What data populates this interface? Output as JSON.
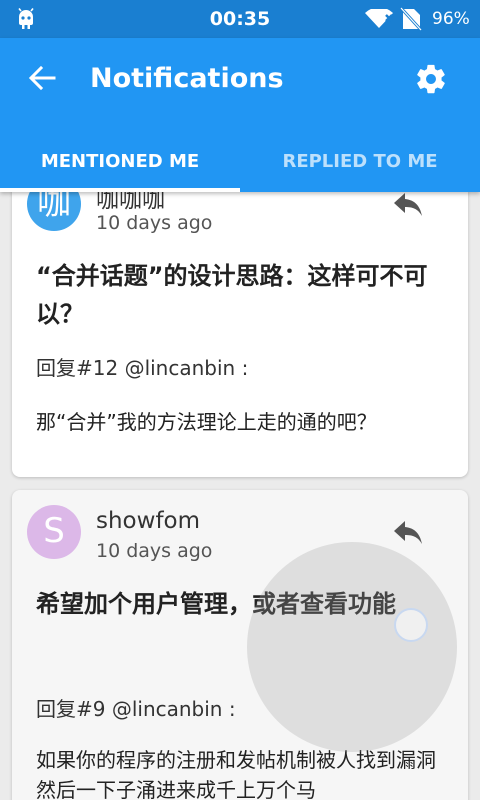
{
  "status_bar": {
    "time": "00:35",
    "battery": "96%"
  },
  "app_bar": {
    "title": "Notifications"
  },
  "tabs": [
    {
      "label": "MENTIONED ME",
      "active": true
    },
    {
      "label": "REPLIED TO ME",
      "active": false
    }
  ],
  "notifications": [
    {
      "avatar_letter": "咖",
      "username": "咖咖咖",
      "time": "10 days ago",
      "topic": "“合并话题”的设计思路：这样可不可以？",
      "quote": "回复#12 @lincanbin :",
      "body": "那“合并”我的方法理论上走的通的吧？"
    },
    {
      "avatar_letter": "S",
      "username": "showfom",
      "time": "10 days ago",
      "topic": "希望加个用户管理，或者查看功能",
      "quote": "回复#9 @lincanbin :",
      "body": "如果你的程序的注册和发帖机制被人找到漏洞然后一下子涌进来成千上万个马"
    }
  ],
  "colors": {
    "status_bar": "#1a7fd1",
    "app_bar": "#2196f3",
    "background": "#ebebeb"
  }
}
